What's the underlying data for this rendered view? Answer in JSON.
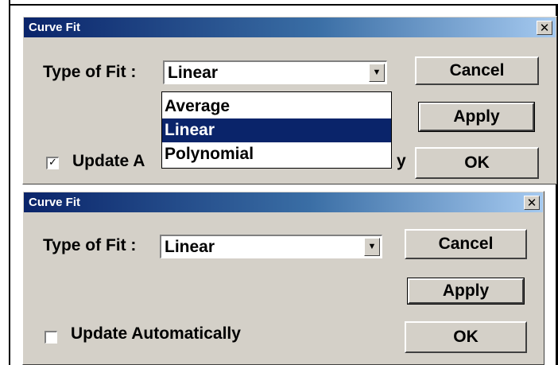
{
  "dialog_top": {
    "title": "Curve Fit",
    "close_glyph": "✕",
    "type_label": "Type of Fit :",
    "combo_value": "Linear",
    "dropdown_arrow": "▼",
    "dropdown_options": [
      "Average",
      "Linear",
      "Polynomial"
    ],
    "selected_option": "Linear",
    "checkbox_checked": true,
    "checkbox_glyph": "✓",
    "checkbox_label": "Update A",
    "checkbox_label_tail": "y",
    "buttons": {
      "cancel": "Cancel",
      "apply": "Apply",
      "ok": "OK"
    }
  },
  "dialog_bottom": {
    "title": "Curve Fit",
    "close_glyph": "✕",
    "type_label": "Type of Fit :",
    "combo_value": "Linear",
    "dropdown_arrow": "▼",
    "checkbox_checked": false,
    "checkbox_label": "Update Automatically",
    "buttons": {
      "cancel": "Cancel",
      "apply": "Apply",
      "ok": "OK"
    }
  },
  "colors": {
    "titlebar_start": "#0a246a",
    "titlebar_end": "#a6caf0",
    "dialog_face": "#d4d0c8",
    "selection": "#0a246a"
  }
}
